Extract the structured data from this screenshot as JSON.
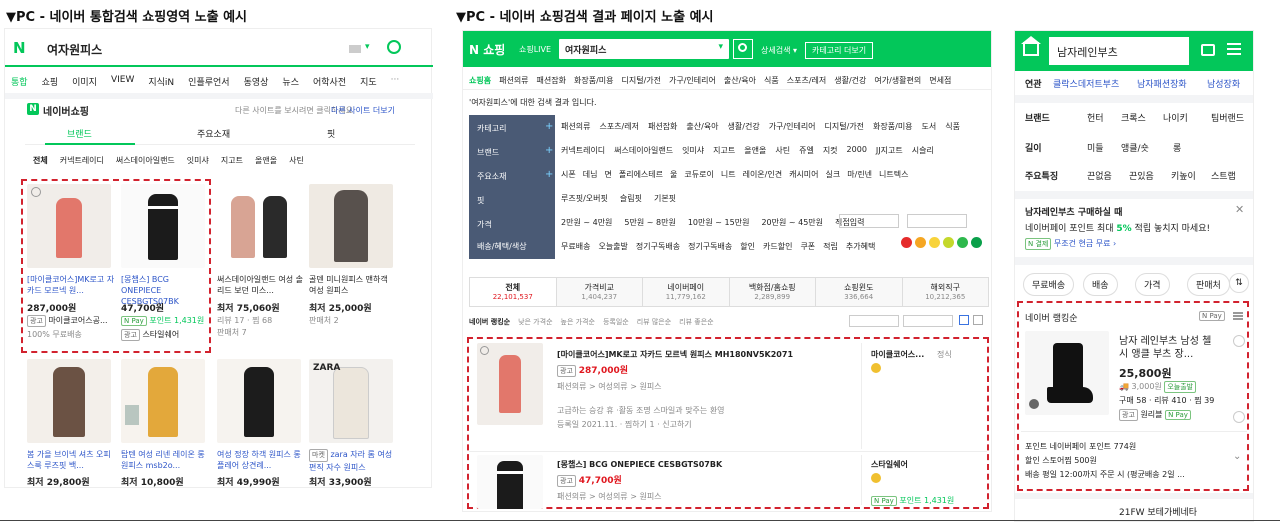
{
  "captions": {
    "left": "▼PC - 네이버 통합검색 쇼핑영역 노출 예시",
    "right": "▼PC - 네이버 쇼핑검색 결과 페이지 노출 예시"
  },
  "left_panel": {
    "search_query": "여자원피스",
    "nav_tabs": [
      "통합",
      "쇼핑",
      "이미지",
      "VIEW",
      "지식iN",
      "인플루언서",
      "동영상",
      "뉴스",
      "어학사전",
      "지도",
      "···"
    ],
    "shopping_title": "네이버쇼핑",
    "shopping_notice": "다른 사이트를 보시려면 클릭하세요",
    "shopping_more": "다른 사이트 더보기",
    "sub_tabs": [
      "브랜드",
      "주요소재",
      "핏"
    ],
    "filters": [
      "전체",
      "커넥트레이디",
      "써스데이아일랜드",
      "잇미샤",
      "지고트",
      "올앤올",
      "사틴"
    ],
    "products_row1": [
      {
        "title": "[마이클코어스]MK로고 자카드 모르넥 원...",
        "price": "287,000원",
        "shop": "마이클코어스공...",
        "extra": "100% 무료배송",
        "ad": "광고"
      },
      {
        "title": "[몽챕스] BCG ONEPIECE CESBGTS07BK",
        "price": "47,700원",
        "shop": "스타일쉐어",
        "extra": "포인트 1,431원",
        "ad": "광고"
      },
      {
        "title": "써스데이아일랜드 여성 솔리드 보던 미스...",
        "price": "최저 75,060원",
        "shop": "",
        "extra": "리뷰 17 · 찜 68",
        "ad": "판매처 7"
      },
      {
        "title": "골덴 미니원피스 맨하객 여성 원피스",
        "price": "최저 25,000원",
        "shop": "",
        "extra": "판매처 2",
        "ad": ""
      }
    ],
    "products_row2": [
      {
        "title": "봄 가을 브이넥 셔츠 오피스룩 루즈핏 백...",
        "price": "최저 29,800원"
      },
      {
        "title": "탑텐 여성 리넨 레이온 롱 원피스 msb2o...",
        "price": "최저 10,800원"
      },
      {
        "title": "여성 정장 하객 원피스 롱 플레어 상견례...",
        "price": "최저 49,990원"
      },
      {
        "title": "zara 자라 롬 여성 편직 자수 원피스",
        "price": "최저 33,900원",
        "badge": "마켓"
      }
    ]
  },
  "middle_panel": {
    "logo": "N 쇼핑",
    "logo_sub": "쇼핑LIVE",
    "search_query": "여자원피스",
    "detail_search": "상세검색 ▾",
    "category_btn": "카테고리 더보기",
    "top_cats": [
      "쇼핑홈",
      "패션의류",
      "패션잡화",
      "화장품/미용",
      "디지털/가전",
      "가구/인테리어",
      "출산/육아",
      "식품",
      "스포츠/레저",
      "생활/건강",
      "여가/생활편의",
      "면세점"
    ],
    "result_notice": "'여자원피스'에 대한 검색 결과 입니다.",
    "filter_labels": [
      "카테고리",
      "브랜드",
      "주요소재",
      "핏",
      "가격",
      "배송/혜택/색상"
    ],
    "filter_rows": [
      [
        "패션의류",
        "스포츠/레저",
        "패션잡화",
        "출산/육아",
        "생활/건강",
        "가구/인테리어",
        "디지털/가전",
        "화장품/미용",
        "도서",
        "식품"
      ],
      [
        "커넥트레이디",
        "써스데이아일랜드",
        "잇미샤",
        "지고트",
        "올앤올",
        "사틴",
        "쥬엘",
        "지컷",
        "2000",
        "JJ지고트",
        "시슬리"
      ],
      [
        "시폰",
        "데님",
        "면",
        "폴리에스테르",
        "울",
        "코듀로이",
        "니트",
        "레이온/인견",
        "캐시미어",
        "실크",
        "마/린넨",
        "니트텍스"
      ],
      [
        "루즈핏/오버핏",
        "슬림핏",
        "기본핏"
      ],
      [
        "2만원 ~ 4만원",
        "5만원 ~ 8만원",
        "10만원 ~ 15만원",
        "20만원 ~ 45만원",
        "직접입력"
      ],
      [
        "무료배송",
        "오늘출발",
        "정기구독배송",
        "정기구독배송",
        "할인",
        "카드할인",
        "쿠폰",
        "적립",
        "추가혜택"
      ]
    ],
    "result_tabs": [
      {
        "label": "전체",
        "count": "22,101,537"
      },
      {
        "label": "가격비교",
        "count": "1,404,237"
      },
      {
        "label": "네이버페이",
        "count": "11,779,162"
      },
      {
        "label": "백화점/홈쇼핑",
        "count": "2,289,899"
      },
      {
        "label": "쇼핑윈도",
        "count": "336,664"
      },
      {
        "label": "해외직구",
        "count": "10,212,365"
      }
    ],
    "sort_options": [
      "네이버 랭킹순",
      "낮은 가격순",
      "높은 가격순",
      "등록일순",
      "리뷰 많은순",
      "리뷰 좋은순"
    ],
    "items": [
      {
        "title": "[마이클코어스]MK로고 자카드 모르넥 원피스 MH180NV5K2071",
        "ad": "광고",
        "price": "287,000원",
        "cat": "패션의류 > 여성의류 > 원피스",
        "desc": "고급하는 승강 휴 ·활동 조명 스마일과 맞주는 환영",
        "date": "등록일 2021.11. · 찜하기 1 · 신고하기",
        "shop": "마이클코어스...",
        "shop_tag": "정식"
      },
      {
        "title": "[몽챕스] BCG ONEPIECE CESBGTS07BK",
        "ad": "광고",
        "price": "47,700원",
        "cat": "패션의류 > 여성의류 > 원피스",
        "shop": "스타일쉐어",
        "shop_tag": "포인트 1,431원"
      }
    ]
  },
  "right_panel": {
    "search_query": "남자레인부츠",
    "related_label": "연관",
    "related": [
      "클락스데저트부츠",
      "남자패션장화",
      "남성장화"
    ],
    "brand_label": "브랜드",
    "brands": [
      "헌터",
      "크록스",
      "나이키",
      "팀버랜드"
    ],
    "length_label": "길이",
    "lengths": [
      "미들",
      "앵클/숏",
      "롱"
    ],
    "feature_label": "주요특징",
    "features": [
      "끈없음",
      "끈있음",
      "키높이",
      "스트랩"
    ],
    "promo_title": "남자레인부츠 구매하실 때",
    "promo_sub_prefix": "네이버페이 포인트 최대 ",
    "promo_sub_rate": "5%",
    "promo_sub_suffix": " 적립 놓치지 마세요!",
    "promo_link": "무조건 현금 무료 ›",
    "promo_badge": "N 결제",
    "chips": [
      "무료배송",
      "배송",
      "가격",
      "판매처"
    ],
    "ranking_label": "네이버 랭킹순",
    "product": {
      "title": "남자 레인부츠 남성 첼시 앵클 부츠 장...",
      "price": "25,800원",
      "shipping": "3,000원",
      "badge": "오늘출발",
      "rating": "구매 58 · 리뷰 410 · 찜 39",
      "ad": "광고",
      "shop": "원리블"
    },
    "point_row": "포인트 네이버페이 포인트 774원",
    "coupon_row": "할인 스토어찜 500원",
    "delivery_row": "배송 평일 12:00까지 주문 시 (평균배송 2일 ...",
    "next_item": "21FW 보테가베네타"
  }
}
